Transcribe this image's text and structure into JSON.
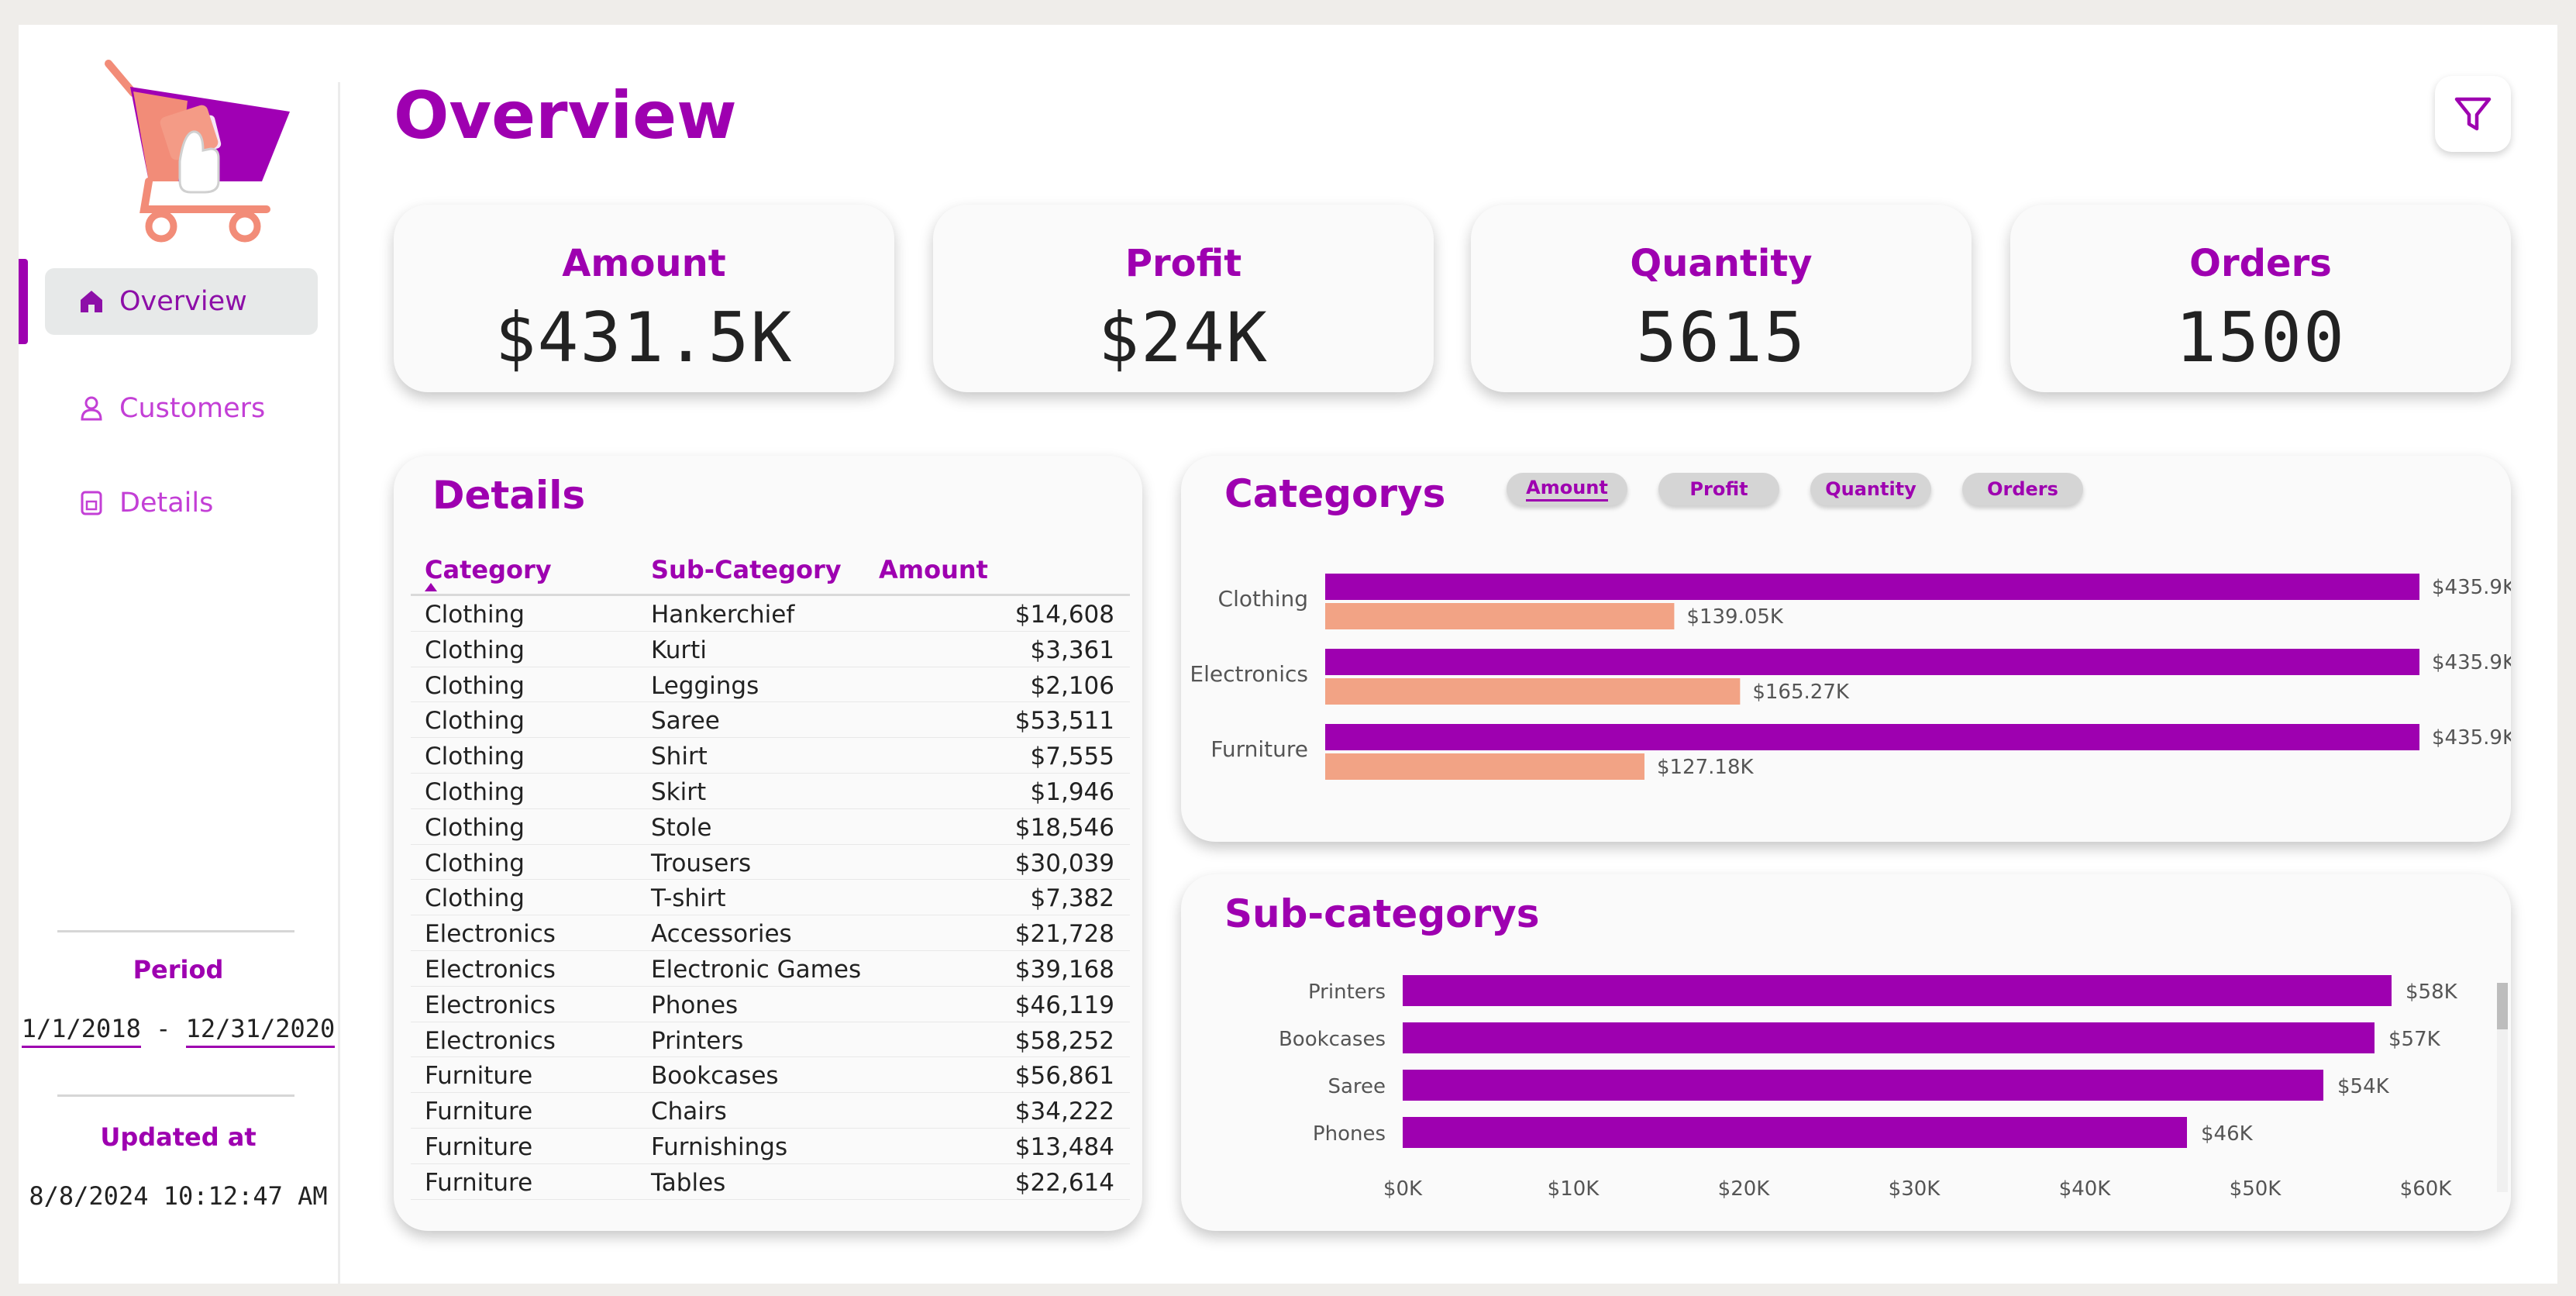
{
  "sidebar": {
    "nav": [
      {
        "label": "Overview",
        "icon": "home-icon",
        "active": true
      },
      {
        "label": "Customers",
        "icon": "person-icon",
        "active": false
      },
      {
        "label": "Details",
        "icon": "document-icon",
        "active": false
      }
    ],
    "period_label": "Period",
    "period_start": "1/1/2018",
    "period_separator": "-",
    "period_end": "12/31/2020",
    "updated_label": "Updated at",
    "updated_value": "8/8/2024 10:12:47 AM"
  },
  "header": {
    "title": "Overview"
  },
  "kpis": [
    {
      "label": "Amount",
      "value": "$431.5K"
    },
    {
      "label": "Profit",
      "value": "$24K"
    },
    {
      "label": "Quantity",
      "value": "5615"
    },
    {
      "label": "Orders",
      "value": "1500"
    }
  ],
  "details": {
    "title": "Details",
    "columns": [
      "Category",
      "Sub-Category",
      "Amount"
    ],
    "rows": [
      [
        "Clothing",
        "Hankerchief",
        "$14,608"
      ],
      [
        "Clothing",
        "Kurti",
        "$3,361"
      ],
      [
        "Clothing",
        "Leggings",
        "$2,106"
      ],
      [
        "Clothing",
        "Saree",
        "$53,511"
      ],
      [
        "Clothing",
        "Shirt",
        "$7,555"
      ],
      [
        "Clothing",
        "Skirt",
        "$1,946"
      ],
      [
        "Clothing",
        "Stole",
        "$18,546"
      ],
      [
        "Clothing",
        "Trousers",
        "$30,039"
      ],
      [
        "Clothing",
        "T-shirt",
        "$7,382"
      ],
      [
        "Electronics",
        "Accessories",
        "$21,728"
      ],
      [
        "Electronics",
        "Electronic Games",
        "$39,168"
      ],
      [
        "Electronics",
        "Phones",
        "$46,119"
      ],
      [
        "Electronics",
        "Printers",
        "$58,252"
      ],
      [
        "Furniture",
        "Bookcases",
        "$56,861"
      ],
      [
        "Furniture",
        "Chairs",
        "$34,222"
      ],
      [
        "Furniture",
        "Furnishings",
        "$13,484"
      ],
      [
        "Furniture",
        "Tables",
        "$22,614"
      ]
    ]
  },
  "categories_panel": {
    "title": "Categorys",
    "toggles": [
      "Amount",
      "Profit",
      "Quantity",
      "Orders"
    ],
    "selected_toggle": "Amount"
  },
  "subcategories_panel": {
    "title": "Sub-categorys"
  },
  "colors": {
    "accent": "#9e00b0",
    "secondary": "#f2a385",
    "nav_text": "#c33fd6"
  },
  "chart_data": [
    {
      "type": "bar",
      "orientation": "horizontal",
      "title": "Categorys",
      "categories": [
        "Clothing",
        "Electronics",
        "Furniture"
      ],
      "series": [
        {
          "values": [
            435.9,
            435.9,
            435.9
          ],
          "labels": [
            "$435.9K",
            "$435.9K",
            "$435.9K"
          ],
          "color": "#9e00b0"
        },
        {
          "values": [
            139.05,
            165.27,
            127.18
          ],
          "labels": [
            "$139.05K",
            "$165.27K",
            "$127.18K"
          ],
          "color": "#f2a385"
        }
      ],
      "xlim": [
        0,
        435.9
      ]
    },
    {
      "type": "bar",
      "orientation": "horizontal",
      "title": "Sub-categorys",
      "categories": [
        "Printers",
        "Bookcases",
        "Saree",
        "Phones"
      ],
      "values": [
        58,
        57,
        54,
        46
      ],
      "labels": [
        "$58K",
        "$57K",
        "$54K",
        "$46K"
      ],
      "xticks": [
        "$0K",
        "$10K",
        "$20K",
        "$30K",
        "$40K",
        "$50K",
        "$60K"
      ],
      "xlim": [
        0,
        60
      ]
    }
  ]
}
